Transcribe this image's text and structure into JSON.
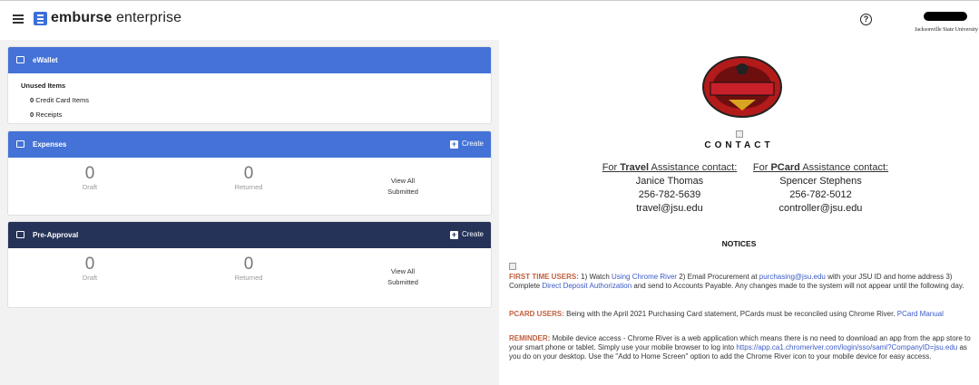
{
  "header": {
    "brand_bold": "emburse",
    "brand_rest": " enterprise",
    "help_icon": "?",
    "user_name": "(redacted)",
    "user_org": "Jacksonville State University",
    "accent": "#3b6fd8"
  },
  "ewallet": {
    "title": "eWallet",
    "unused_label": "Unused Items",
    "credit_count": "0",
    "credit_label": " Credit Card Items",
    "receipt_count": "0",
    "receipt_label": " Receipts",
    "color": "#4472d6"
  },
  "expenses": {
    "title": "Expenses",
    "create_label": "Create",
    "draft_value": "0",
    "draft_label": "Draft",
    "returned_value": "0",
    "returned_label": "Returned",
    "view_all_line1": "View All",
    "view_all_line2": "Submitted",
    "color": "#4472d6"
  },
  "preapproval": {
    "title": "Pre-Approval",
    "create_label": "Create",
    "draft_value": "0",
    "draft_label": "Draft",
    "returned_value": "0",
    "returned_label": "Returned",
    "view_all_line1": "View All",
    "view_all_line2": "Submitted",
    "color": "#263358"
  },
  "contact": {
    "title": "CONTACT",
    "travel": {
      "head_pre": "For ",
      "head_bold": "Travel",
      "head_post": " Assistance contact:",
      "name": "Janice Thomas",
      "phone": "256-782-5639",
      "email": "travel@jsu.edu"
    },
    "pcard": {
      "head_pre": "For ",
      "head_bold": "PCard",
      "head_post": " Assistance contact:",
      "name": "Spencer Stephens",
      "phone": "256-782-5012",
      "email": "controller@jsu.edu"
    }
  },
  "notices": {
    "title": "NOTICES",
    "first": {
      "tag": "FIRST TIME USERS:",
      "t1": "    1) Watch ",
      "l1": "Using Chrome River",
      "t2": "   2) Email Procurement at ",
      "l2": "purchasing@jsu.edu",
      "t3": " with your JSU ID and home address  3) Complete ",
      "l3": "Direct Deposit Authorization",
      "t4": " and send to Accounts Payable.  Any changes made to the system will not appear until the following day."
    },
    "pcard": {
      "tag": "PCARD USERS:",
      "t1": "   Being with the April 2021 Purchasing Card statement, PCards must be reconciled using Chrome River.  ",
      "l1": "PCard Manual"
    },
    "reminder": {
      "tag": "REMINDER:",
      "t1": "   Mobile device access - Chrome River is a web application which means there is no need to download an app from the app store to your smart phone or tablet.  Simply use your mobile browser to log into ",
      "l1": "https://app.ca1.chromeriver.com/login/sso/saml?CompanyID=jsu.edu",
      "t2": " as you do on your desktop.  Use the \"Add to Home Screen\" option to add the Chrome River icon to your mobile device for easy access."
    },
    "tag_color": "#c0603e",
    "link_color": "#3b5bc6"
  },
  "seal": {
    "line1": "JACKSONVILLE STATE",
    "line2": "GAMECOCKS"
  }
}
